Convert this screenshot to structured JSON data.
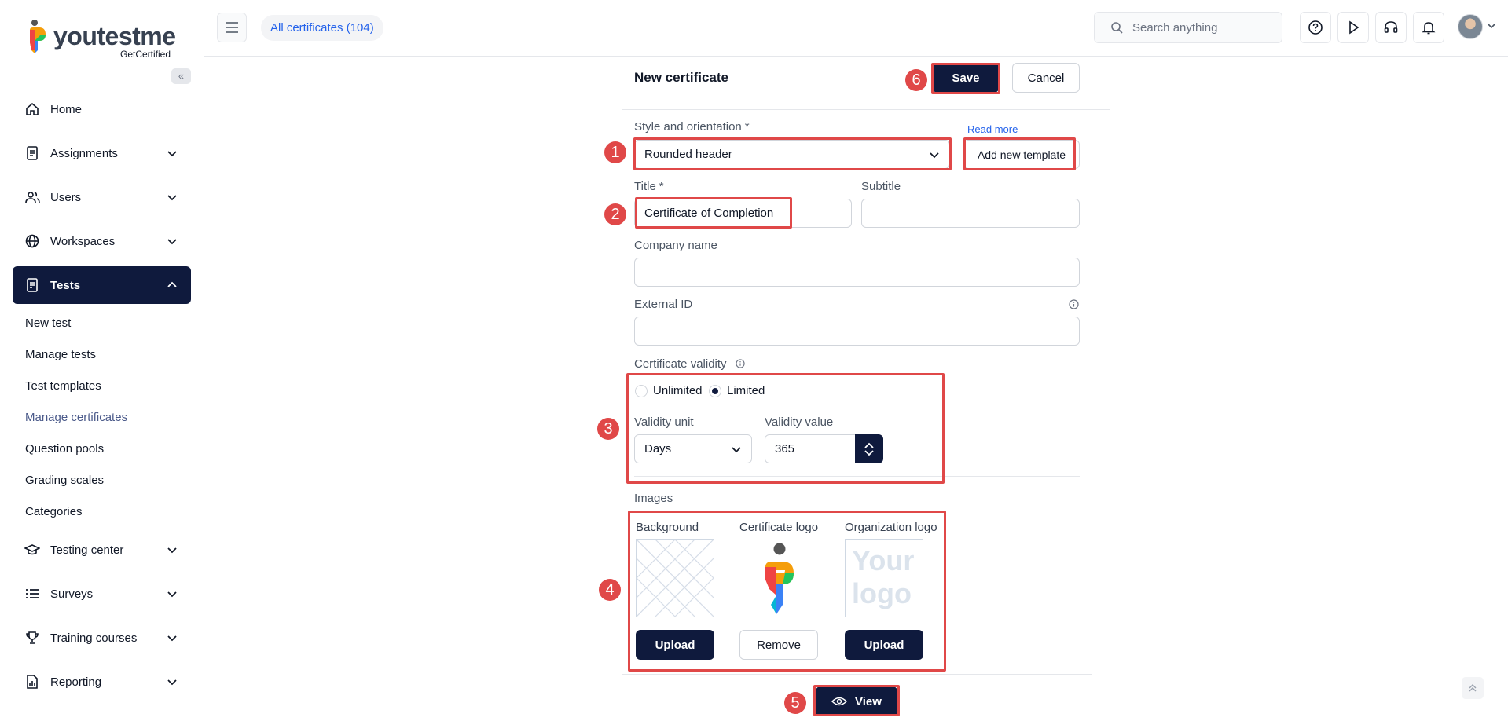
{
  "sidebar": {
    "logo_text": "youtestme",
    "logo_sub": "GetCertified",
    "collapse_glyph": "«",
    "items": [
      {
        "label": "Home",
        "icon": "home-icon"
      },
      {
        "label": "Assignments",
        "icon": "assignments-icon"
      },
      {
        "label": "Users",
        "icon": "users-icon"
      },
      {
        "label": "Workspaces",
        "icon": "globe-icon"
      },
      {
        "label": "Tests",
        "icon": "tests-icon"
      },
      {
        "label": "Testing center",
        "icon": "graduation-cap-icon"
      },
      {
        "label": "Surveys",
        "icon": "list-icon"
      },
      {
        "label": "Training courses",
        "icon": "trophy-icon"
      },
      {
        "label": "Reporting",
        "icon": "report-icon"
      }
    ],
    "tests_sub": [
      "New test",
      "Manage tests",
      "Test templates",
      "Manage certificates",
      "Question pools",
      "Grading scales",
      "Categories"
    ]
  },
  "topbar": {
    "breadcrumb": "All certificates (104)",
    "search_placeholder": "Search anything"
  },
  "form": {
    "title": "New certificate",
    "save_label": "Save",
    "cancel_label": "Cancel",
    "style_label": "Style and orientation",
    "required_mark": "*",
    "read_more": "Read more",
    "style_value": "Rounded header",
    "add_template": "Add new template",
    "title_label": "Title",
    "title_value": "Certificate of Completion",
    "subtitle_label": "Subtitle",
    "subtitle_value": "",
    "company_label": "Company name",
    "company_value": "",
    "external_id_label": "External ID",
    "external_id_value": "",
    "validity_label": "Certificate validity",
    "unlimited_label": "Unlimited",
    "limited_label": "Limited",
    "validity_selected": "Limited",
    "validity_unit_label": "Validity unit",
    "validity_unit_value": "Days",
    "validity_value_label": "Validity value",
    "validity_value": "365",
    "images_label": "Images",
    "background_label": "Background",
    "certificate_logo_label": "Certificate logo",
    "organization_logo_label": "Organization logo",
    "org_logo_placeholder_line1": "Your",
    "org_logo_placeholder_line2": "logo",
    "upload_label": "Upload",
    "remove_label": "Remove",
    "view_label": "View"
  },
  "annotations": [
    "1",
    "2",
    "3",
    "4",
    "5",
    "6"
  ],
  "colors": {
    "primary": "#0f1a3d",
    "highlight": "#e04848",
    "link": "#2563eb"
  }
}
